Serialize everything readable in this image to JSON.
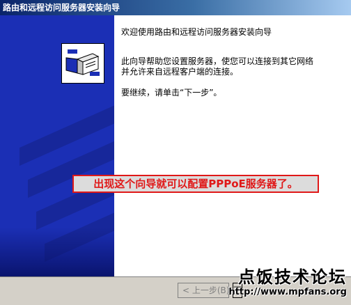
{
  "window": {
    "title": "路由和远程访问服务器安装向导"
  },
  "wizard": {
    "welcome": "欢迎使用路由和远程访问服务器安装向导",
    "description": "此向导帮助您设置服务器，使您可以连接到其它网络\n并允许来自远程客户端的连接。",
    "continue_hint": "要继续，请单击“下一步”。",
    "logo_icon": "server-network-icon"
  },
  "annotation": {
    "text": "出现这个向导就可以配置PPPoE服务器了。",
    "color": "#e01818"
  },
  "buttons": {
    "back_label": "< 上一步(B)",
    "next_label": "下"
  },
  "watermark": {
    "title": "点饭技术论坛",
    "url": "http://www.mpfans.org"
  },
  "colors": {
    "banner": "#1b2fb5",
    "titlebar": "#0a246a",
    "dialog": "#d4d0c8"
  }
}
